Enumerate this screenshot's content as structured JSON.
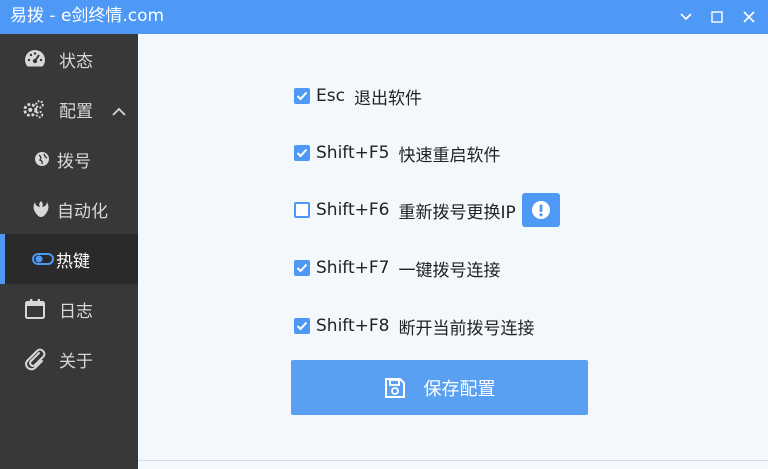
{
  "window": {
    "title": "易拨 - e剑终情.com"
  },
  "sidebar": {
    "items": [
      {
        "label": "状态",
        "icon": "speedometer-icon"
      },
      {
        "label": "配置",
        "icon": "gears-icon",
        "expanded": true
      },
      {
        "label": "拨号",
        "icon": "globe-icon"
      },
      {
        "label": "自动化",
        "icon": "rebel-icon"
      },
      {
        "label": "热键",
        "icon": "toggle-icon",
        "active": true
      },
      {
        "label": "日志",
        "icon": "calendar-icon"
      },
      {
        "label": "关于",
        "icon": "paperclip-icon"
      }
    ]
  },
  "hotkeys": [
    {
      "key": "Esc",
      "action": "退出软件",
      "checked": true
    },
    {
      "key": "Shift+F5",
      "action": "快速重启软件",
      "checked": true
    },
    {
      "key": "Shift+F6",
      "action": "重新拨号更换IP",
      "checked": false,
      "warning": true
    },
    {
      "key": "Shift+F7",
      "action": "一键拨号连接",
      "checked": true
    },
    {
      "key": "Shift+F8",
      "action": "断开当前拨号连接",
      "checked": true
    }
  ],
  "save_button": {
    "label": "保存配置"
  },
  "colors": {
    "accent": "#4e99f6",
    "sidebar_bg": "#383838",
    "content_bg": "#f3f8fd"
  }
}
